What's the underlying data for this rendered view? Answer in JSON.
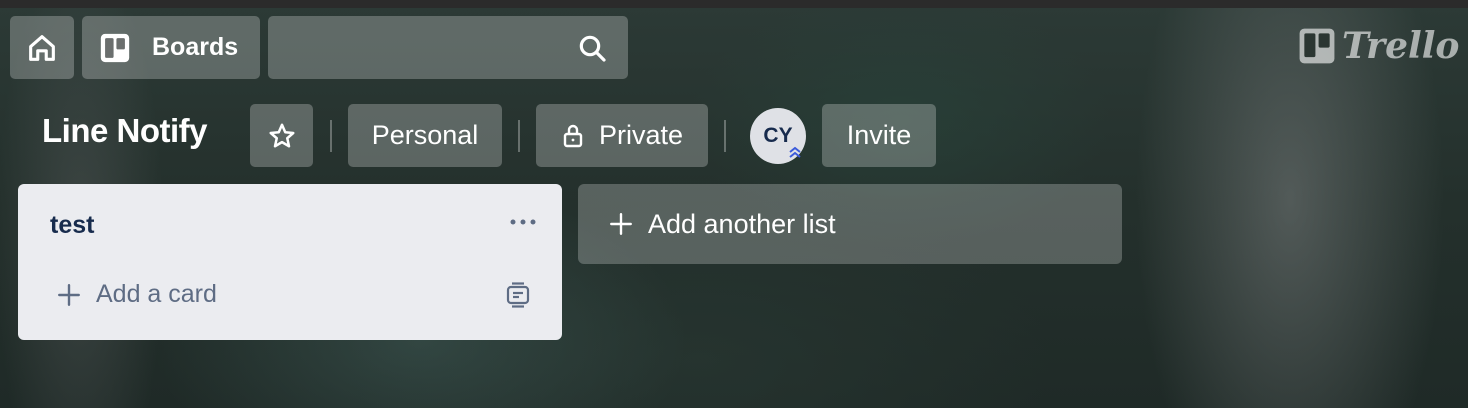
{
  "header": {
    "home_icon": "home-icon",
    "boards_label": "Boards",
    "boards_icon": "boards-icon",
    "search_icon": "search-icon",
    "search_value": "",
    "logo_text": "Trello"
  },
  "board": {
    "title": "Line Notify",
    "star_icon": "star-icon",
    "team_label": "Personal",
    "visibility_label": "Private",
    "visibility_icon": "lock-icon",
    "member_initials": "CY",
    "invite_label": "Invite"
  },
  "lists": [
    {
      "title": "test",
      "menu_icon": "more-icon",
      "add_card_label": "Add a card",
      "template_icon": "card-template-icon"
    }
  ],
  "add_list_label": "Add another list",
  "colors": {
    "list_bg": "#ebecf0",
    "list_title": "#172b4d",
    "muted_text": "#5e6c84"
  }
}
